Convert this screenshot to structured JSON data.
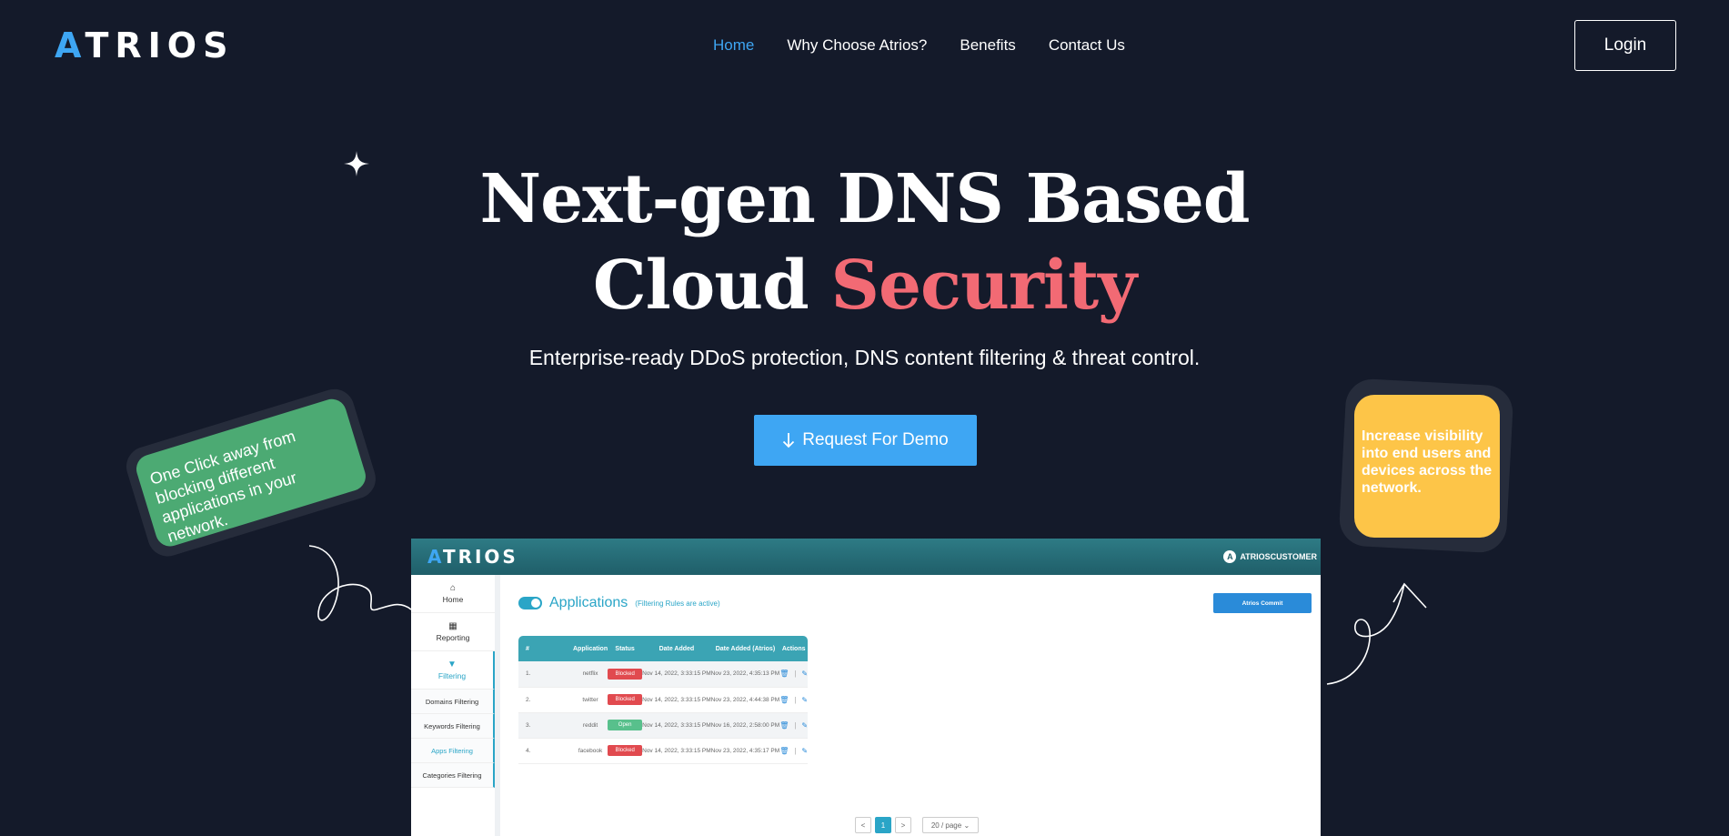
{
  "brand": {
    "logo_text_a": "A",
    "logo_text_rest": "TRIOS",
    "accent_color": "#3ea6f3"
  },
  "nav": {
    "items": [
      {
        "label": "Home",
        "active": true
      },
      {
        "label": "Why Choose Atrios?",
        "active": false
      },
      {
        "label": "Benefits",
        "active": false
      },
      {
        "label": "Contact Us",
        "active": false
      }
    ],
    "login_label": "Login"
  },
  "hero": {
    "title_line1": "Next-gen DNS Based",
    "title_line2_plain": "Cloud ",
    "title_line2_accent": "Security",
    "subtitle": "Enterprise-ready DDoS protection, DNS content filtering & threat control.",
    "cta_icon": "arrow-down-icon",
    "cta_label": "Request For Demo"
  },
  "stickers": {
    "green_text": "One Click away from blocking different applications in your network.",
    "yellow_text": "Increase visibility into end users and devices across the network."
  },
  "dashboard": {
    "logo_a": "A",
    "logo_rest": "TRIOS",
    "user_initial": "A",
    "user_name": "ATRIOSCUSTOMER",
    "sidebar": {
      "home": "Home",
      "reporting": "Reporting",
      "filtering": "Filtering",
      "sub_items": [
        "Domains Filtering",
        "Keywords Filtering",
        "Apps Filtering",
        "Categories Filtering"
      ]
    },
    "page_title": "Applications",
    "page_note": "(Filtering Rules are active)",
    "commit_label": "Atrios Commit",
    "table": {
      "headers": [
        "#",
        "Application",
        "Status",
        "Date Added",
        "Date Added (Atrios)",
        "Actions"
      ],
      "rows": [
        {
          "num": "1.",
          "app": "netflix",
          "status": "Blocked",
          "date": "Nov 14, 2022, 3:33:15 PM",
          "date_atrios": "Nov 23, 2022, 4:35:13 PM"
        },
        {
          "num": "2.",
          "app": "twitter",
          "status": "Blocked",
          "date": "Nov 14, 2022, 3:33:15 PM",
          "date_atrios": "Nov 23, 2022, 4:44:38 PM"
        },
        {
          "num": "3.",
          "app": "reddit",
          "status": "Open",
          "date": "Nov 14, 2022, 3:33:15 PM",
          "date_atrios": "Nov 16, 2022, 2:58:00 PM"
        },
        {
          "num": "4.",
          "app": "facebook",
          "status": "Blocked",
          "date": "Nov 14, 2022, 3:33:15 PM",
          "date_atrios": "Nov 23, 2022, 4:35:17 PM"
        }
      ]
    },
    "pager": {
      "prev": "<",
      "current": "1",
      "next": ">",
      "page_size": "20 / page"
    }
  }
}
